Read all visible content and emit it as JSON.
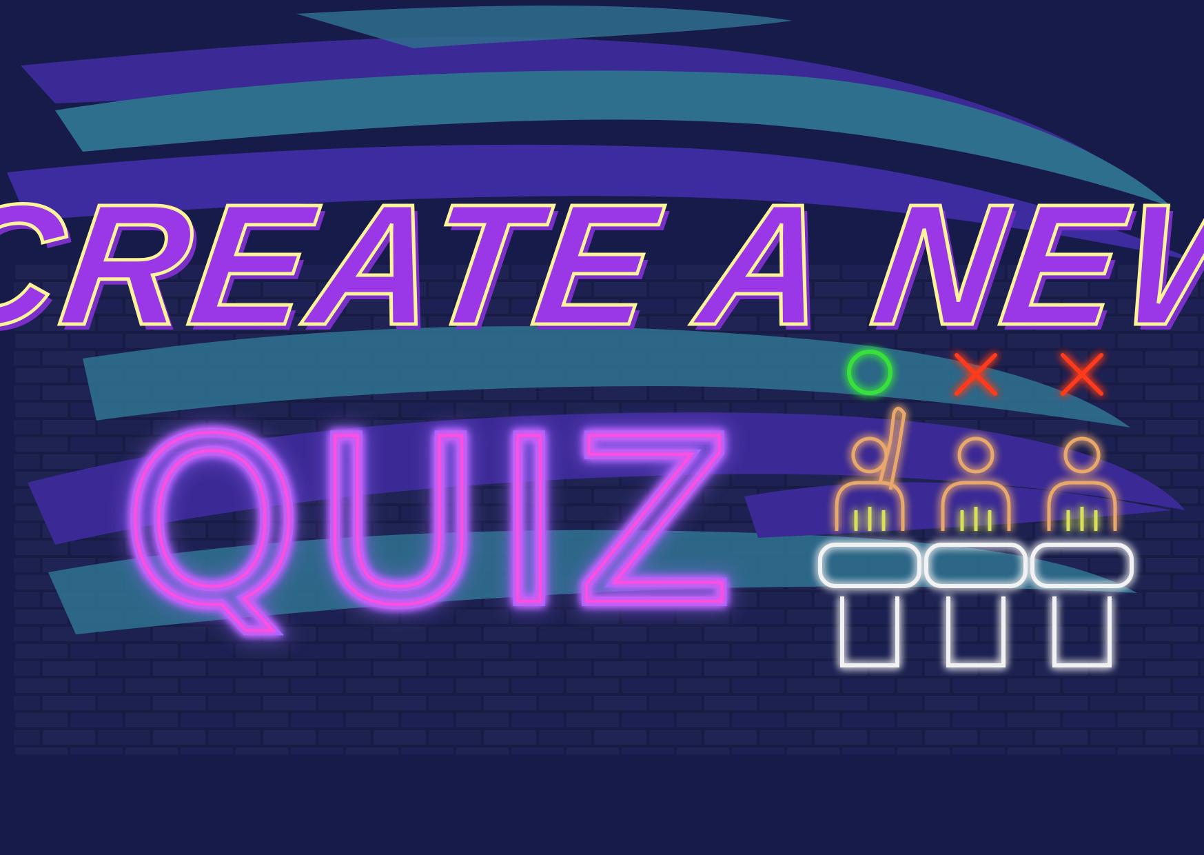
{
  "headline": {
    "line1_letters": [
      "C",
      "R",
      "E",
      "A",
      "T",
      "E",
      " ",
      "A",
      " ",
      "N",
      "E",
      "W"
    ],
    "line2_letters": [
      "Q",
      "U",
      "I",
      "Z"
    ]
  },
  "contestants": [
    {
      "answer": "correct",
      "hand_raised": true
    },
    {
      "answer": "wrong",
      "hand_raised": false
    },
    {
      "answer": "wrong",
      "hand_raised": false
    }
  ],
  "colors": {
    "background": "#161b49",
    "brick_wall": "#1a1e45",
    "paint_teal": "#2f6f8e",
    "paint_purple": "#3b2a95",
    "headline_fill": "#9a38e8",
    "headline_outline": "#fff49a",
    "neon_pink": "#ff4fe0",
    "neon_violet": "#a06bff",
    "neon_correct": "#38e03b",
    "neon_wrong": "#ff3b1d",
    "neon_person": "#e8a86c",
    "neon_podium": "#f2f2f2"
  },
  "icons": [
    "correct-circle-icon",
    "wrong-cross-icon",
    "contestant-icon",
    "podium-icon"
  ]
}
